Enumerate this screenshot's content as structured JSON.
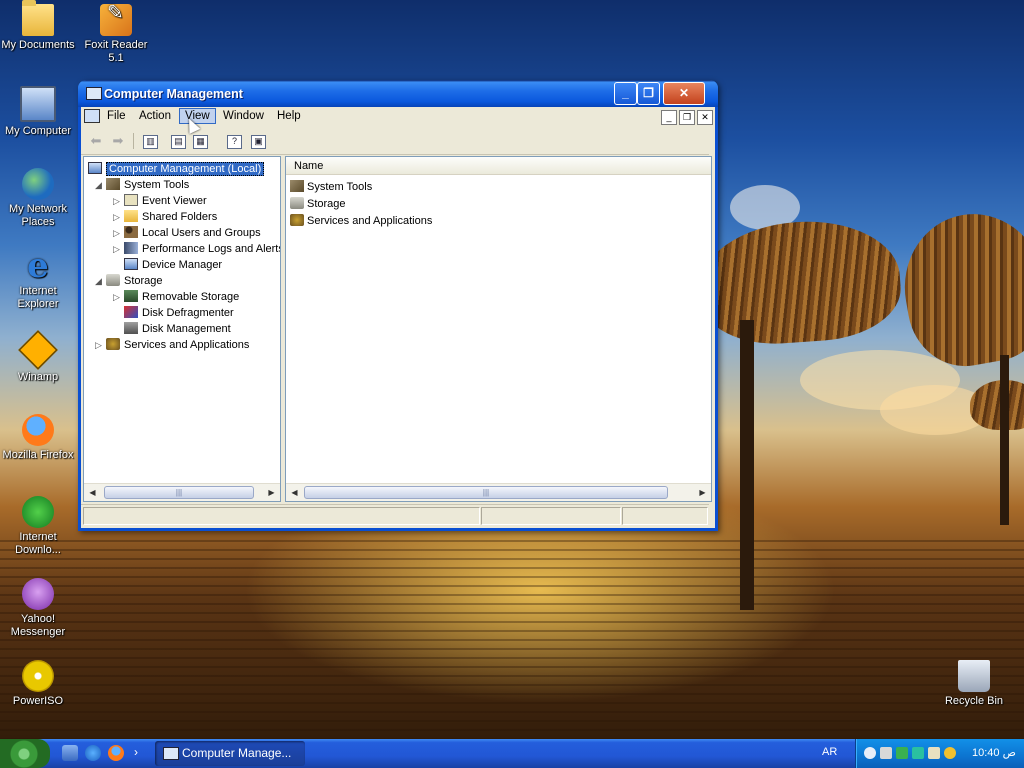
{
  "desktop": {
    "icons": [
      {
        "label": "My Documents",
        "icon": "my-documents-icon"
      },
      {
        "label": "Foxit Reader 5.1",
        "icon": "foxit-reader-icon"
      },
      {
        "label": "My Computer",
        "icon": "my-computer-icon"
      },
      {
        "label": "My Network Places",
        "icon": "network-places-icon"
      },
      {
        "label": "Internet Explorer",
        "icon": "internet-explorer-icon"
      },
      {
        "label": "Winamp",
        "icon": "winamp-icon"
      },
      {
        "label": "Mozilla Firefox",
        "icon": "firefox-icon"
      },
      {
        "label": "Internet Downlo...",
        "icon": "internet-download-manager-icon"
      },
      {
        "label": "Yahoo! Messenger",
        "icon": "yahoo-messenger-icon"
      },
      {
        "label": "PowerISO",
        "icon": "poweriso-icon"
      },
      {
        "label": "Recycle Bin",
        "icon": "recycle-bin-icon"
      }
    ]
  },
  "window": {
    "title": "Computer Management",
    "menu": [
      "File",
      "Action",
      "View",
      "Window",
      "Help"
    ],
    "active_menu": "View",
    "tree": {
      "root": "Computer Management (Local)",
      "system_tools": {
        "label": "System Tools",
        "children": [
          "Event Viewer",
          "Shared Folders",
          "Local Users and Groups",
          "Performance Logs and Alerts",
          "Device Manager"
        ]
      },
      "storage": {
        "label": "Storage",
        "children": [
          "Removable Storage",
          "Disk Defragmenter",
          "Disk Management"
        ]
      },
      "services": "Services and Applications"
    },
    "list": {
      "column": "Name",
      "items": [
        "System Tools",
        "Storage",
        "Services and Applications"
      ]
    }
  },
  "taskbar": {
    "task_label": "Computer Manage...",
    "language": "AR",
    "clock": "10:40 ص"
  }
}
